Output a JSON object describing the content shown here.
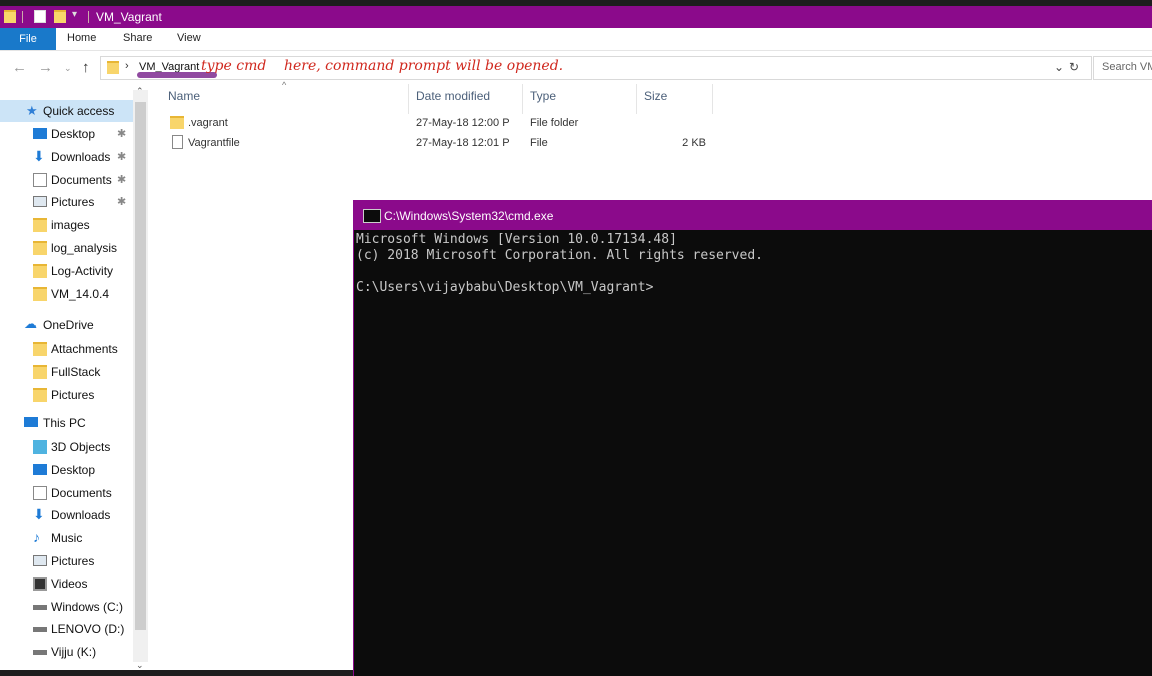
{
  "window": {
    "title": "VM_Vagrant"
  },
  "ribbon": {
    "file": "File",
    "home": "Home",
    "share": "Share",
    "view": "View"
  },
  "address": {
    "path": "VM_Vagrant",
    "annotation_cmd": "type cmd",
    "annotation_rest": "here, command prompt will be opened.",
    "search_placeholder": "Search VM"
  },
  "navpane": {
    "quick_access": "Quick access",
    "quick_items": [
      {
        "label": "Desktop",
        "icon": "desktop-icon",
        "pinned": true
      },
      {
        "label": "Downloads",
        "icon": "download-icon",
        "pinned": true
      },
      {
        "label": "Documents",
        "icon": "documents-icon",
        "pinned": true
      },
      {
        "label": "Pictures",
        "icon": "pictures-icon",
        "pinned": true
      },
      {
        "label": "images",
        "icon": "folder-icon",
        "pinned": false
      },
      {
        "label": "log_analysis",
        "icon": "folder-icon",
        "pinned": false
      },
      {
        "label": "Log-Activity",
        "icon": "folder-icon",
        "pinned": false
      },
      {
        "label": "VM_14.0.4",
        "icon": "folder-icon",
        "pinned": false
      }
    ],
    "onedrive": "OneDrive",
    "onedrive_items": [
      {
        "label": "Attachments",
        "icon": "folder-icon"
      },
      {
        "label": "FullStack",
        "icon": "folder-icon"
      },
      {
        "label": "Pictures",
        "icon": "folder-icon"
      }
    ],
    "thispc": "This PC",
    "pc_items": [
      {
        "label": "3D Objects",
        "icon": "cube-icon"
      },
      {
        "label": "Desktop",
        "icon": "desktop-icon"
      },
      {
        "label": "Documents",
        "icon": "documents-icon"
      },
      {
        "label": "Downloads",
        "icon": "download-icon"
      },
      {
        "label": "Music",
        "icon": "music-icon"
      },
      {
        "label": "Pictures",
        "icon": "pictures-icon"
      },
      {
        "label": "Videos",
        "icon": "videos-icon"
      },
      {
        "label": "Windows (C:)",
        "icon": "drive-icon"
      },
      {
        "label": "LENOVO (D:)",
        "icon": "drive-icon"
      },
      {
        "label": "Vijju (K:)",
        "icon": "drive-icon"
      }
    ]
  },
  "filelist": {
    "columns": [
      "Name",
      "Date modified",
      "Type",
      "Size"
    ],
    "rows": [
      {
        "name": ".vagrant",
        "date": "27-May-18 12:00 P",
        "type": "File folder",
        "size": ""
      },
      {
        "name": "Vagrantfile",
        "date": "27-May-18 12:01 P",
        "type": "File",
        "size": "2 KB"
      }
    ]
  },
  "cmd": {
    "title": "C:\\Windows\\System32\\cmd.exe",
    "lines": [
      "Microsoft Windows [Version 10.0.17134.48]",
      "(c) 2018 Microsoft Corporation. All rights reserved.",
      "",
      "C:\\Users\\vijaybabu\\Desktop\\VM_Vagrant>"
    ]
  },
  "colors": {
    "titlebar": "#8b0a8b",
    "file_tab": "#1979ca",
    "annotation": "#d0281e"
  }
}
